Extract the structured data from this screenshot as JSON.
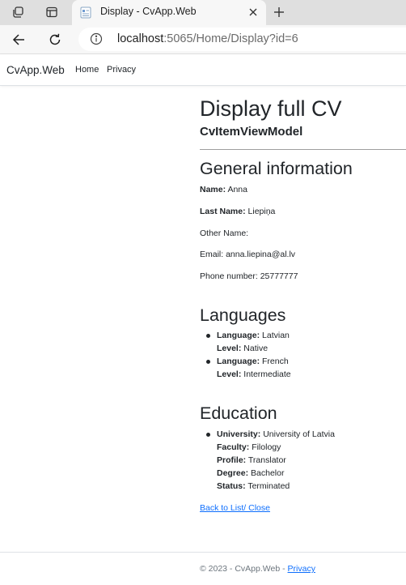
{
  "browser": {
    "tab_title": "Display - CvApp.Web",
    "url_host": "localhost",
    "url_rest": ":5065/Home/Display?id=6"
  },
  "site": {
    "brand": "CvApp.Web",
    "nav": [
      "Home",
      "Privacy"
    ]
  },
  "page": {
    "title": "Display full CV",
    "model_name": "CvItemViewModel"
  },
  "general": {
    "heading": "General information",
    "name_label": "Name:",
    "name_value": "Anna",
    "last_name_label": "Last Name:",
    "last_name_value": "Liepiņa",
    "other_name_text": "Other Name:",
    "email_text": "Email: anna.liepina@al.lv",
    "phone_text": "Phone number: 25777777"
  },
  "languages": {
    "heading": "Languages",
    "language_label": "Language:",
    "level_label": "Level:",
    "items": [
      {
        "language": "Latvian",
        "level": "Native"
      },
      {
        "language": "French",
        "level": "Intermediate"
      }
    ]
  },
  "education": {
    "heading": "Education",
    "university_label": "University:",
    "university": "University of Latvia",
    "faculty_label": "Faculty:",
    "faculty": "Filology",
    "profile_label": "Profile:",
    "profile": "Translator",
    "degree_label": "Degree:",
    "degree": "Bachelor",
    "status_label": "Status:",
    "status": "Terminated"
  },
  "links": {
    "back": "Back to List/ Close"
  },
  "footer": {
    "text": "© 2023 - CvApp.Web - ",
    "privacy": "Privacy"
  },
  "colors": {
    "link": "#0d6efd",
    "text": "#212529",
    "chrome": "#dfdfdf"
  }
}
